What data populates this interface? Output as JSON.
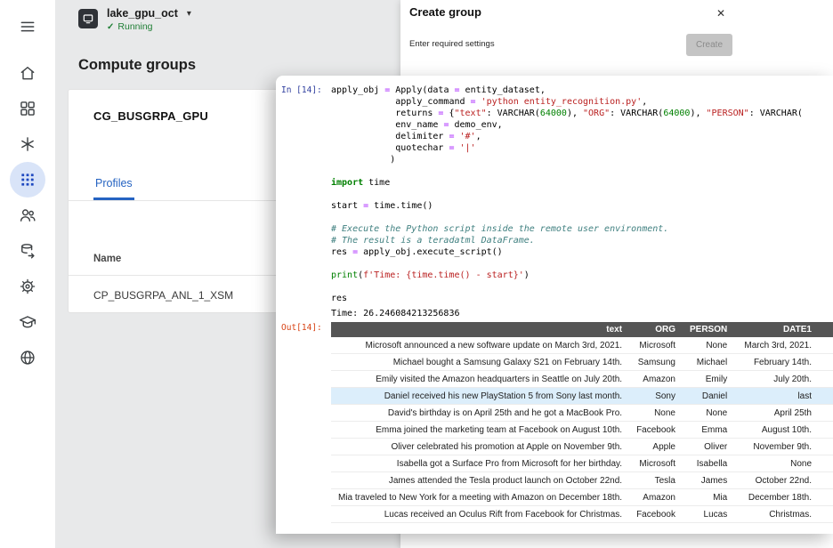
{
  "colors": {
    "accent_blue": "#2563c2",
    "active_icon_blue": "#1f49c0",
    "active_icon_bg": "#d9e4f8",
    "running_green": "#1e7e34",
    "in_prompt": "#303F9F",
    "out_prompt": "#D84315",
    "table_header_bg": "#555555",
    "row_highlight": "#dceefb"
  },
  "topbar": {
    "env_name": "lake_gpu_oct",
    "caret": "▾",
    "status_check": "✓",
    "status": "Running"
  },
  "sidebar": {
    "icons": [
      "menu-icon",
      "home-icon",
      "apps-grid-icon",
      "asterisk-icon",
      "compute-groups-icon",
      "users-icon",
      "data-source-icon",
      "settings-gear-icon",
      "learning-cap-icon",
      "globe-icon"
    ],
    "active_icon": "compute-groups-icon"
  },
  "main": {
    "title": "Compute groups",
    "card": {
      "title": "CG_BUSGRPA_GPU",
      "tab": "Profiles",
      "column_header": "Name",
      "rows": [
        "CP_BUSGRPA_ANL_1_XSM"
      ]
    }
  },
  "create_group": {
    "title": "Create group",
    "subtitle": "Enter required settings",
    "create_button": "Create",
    "close": "✕"
  },
  "notebook": {
    "in_label": "In [14]:",
    "out_label": "Out[14]:",
    "stdout": "Time: 26.246084213256836",
    "code_lines": [
      [
        {
          "t": "apply_obj ",
          "c": "n"
        },
        {
          "t": "=",
          "c": "o"
        },
        {
          "t": " Apply(data ",
          "c": "n"
        },
        {
          "t": "=",
          "c": "o"
        },
        {
          "t": " entity_dataset,",
          "c": "n"
        }
      ],
      [
        {
          "t": "            apply_command ",
          "c": "n"
        },
        {
          "t": "=",
          "c": "o"
        },
        {
          "t": " ",
          "c": "n"
        },
        {
          "t": "'python entity_recognition.py'",
          "c": "s"
        },
        {
          "t": ",",
          "c": "n"
        }
      ],
      [
        {
          "t": "            returns ",
          "c": "n"
        },
        {
          "t": "=",
          "c": "o"
        },
        {
          "t": " {",
          "c": "n"
        },
        {
          "t": "\"text\"",
          "c": "s"
        },
        {
          "t": ": VARCHAR(",
          "c": "n"
        },
        {
          "t": "64000",
          "c": "m"
        },
        {
          "t": "), ",
          "c": "n"
        },
        {
          "t": "\"ORG\"",
          "c": "s"
        },
        {
          "t": ": VARCHAR(",
          "c": "n"
        },
        {
          "t": "64000",
          "c": "m"
        },
        {
          "t": "), ",
          "c": "n"
        },
        {
          "t": "\"PERSON\"",
          "c": "s"
        },
        {
          "t": ": VARCHAR(",
          "c": "n"
        }
      ],
      [
        {
          "t": "            env_name ",
          "c": "n"
        },
        {
          "t": "=",
          "c": "o"
        },
        {
          "t": " demo_env,",
          "c": "n"
        }
      ],
      [
        {
          "t": "            delimiter ",
          "c": "n"
        },
        {
          "t": "=",
          "c": "o"
        },
        {
          "t": " ",
          "c": "n"
        },
        {
          "t": "'#'",
          "c": "s"
        },
        {
          "t": ",",
          "c": "n"
        }
      ],
      [
        {
          "t": "            quotechar ",
          "c": "n"
        },
        {
          "t": "=",
          "c": "o"
        },
        {
          "t": " ",
          "c": "n"
        },
        {
          "t": "'|'",
          "c": "s"
        }
      ],
      [
        {
          "t": "           )",
          "c": "n"
        }
      ],
      [],
      [
        {
          "t": "import",
          "c": "k"
        },
        {
          "t": " time",
          "c": "n"
        }
      ],
      [],
      [
        {
          "t": "start ",
          "c": "n"
        },
        {
          "t": "=",
          "c": "o"
        },
        {
          "t": " time.time()",
          "c": "n"
        }
      ],
      [],
      [
        {
          "t": "# Execute the Python script inside the remote user environment.",
          "c": "c"
        }
      ],
      [
        {
          "t": "# The result is a teradatml DataFrame.",
          "c": "c"
        }
      ],
      [
        {
          "t": "res ",
          "c": "n"
        },
        {
          "t": "=",
          "c": "o"
        },
        {
          "t": " apply_obj.execute_script()",
          "c": "n"
        }
      ],
      [],
      [
        {
          "t": "print",
          "c": "b"
        },
        {
          "t": "(",
          "c": "n"
        },
        {
          "t": "f'Time: {time.time() - start}'",
          "c": "s"
        },
        {
          "t": ")",
          "c": "n"
        }
      ],
      [],
      [
        {
          "t": "res",
          "c": "n"
        }
      ]
    ],
    "table": {
      "columns": [
        "text",
        "ORG",
        "PERSON",
        "DATE1"
      ],
      "highlighted_row": 3,
      "rows": [
        [
          "Microsoft announced a new software update on March 3rd, 2021.",
          "Microsoft",
          "None",
          "March 3rd, 2021."
        ],
        [
          "Michael bought a Samsung Galaxy S21 on February 14th.",
          "Samsung",
          "Michael",
          "February 14th."
        ],
        [
          "Emily visited the Amazon headquarters in Seattle on July 20th.",
          "Amazon",
          "Emily",
          "July 20th."
        ],
        [
          "Daniel received his new PlayStation 5 from Sony last month.",
          "Sony",
          "Daniel",
          "last"
        ],
        [
          "David's birthday is on April 25th and he got a MacBook Pro.",
          "None",
          "None",
          "April 25th"
        ],
        [
          "Emma joined the marketing team at Facebook on August 10th.",
          "Facebook",
          "Emma",
          "August 10th."
        ],
        [
          "Oliver celebrated his promotion at Apple on November 9th.",
          "Apple",
          "Oliver",
          "November 9th."
        ],
        [
          "Isabella got a Surface Pro from Microsoft for her birthday.",
          "Microsoft",
          "Isabella",
          "None"
        ],
        [
          "James attended the Tesla product launch on October 22nd.",
          "Tesla",
          "James",
          "October 22nd."
        ],
        [
          "Mia traveled to New York for a meeting with Amazon on December 18th.",
          "Amazon",
          "Mia",
          "December 18th."
        ],
        [
          "Lucas received an Oculus Rift from Facebook for Christmas.",
          "Facebook",
          "Lucas",
          "Christmas."
        ]
      ]
    }
  }
}
